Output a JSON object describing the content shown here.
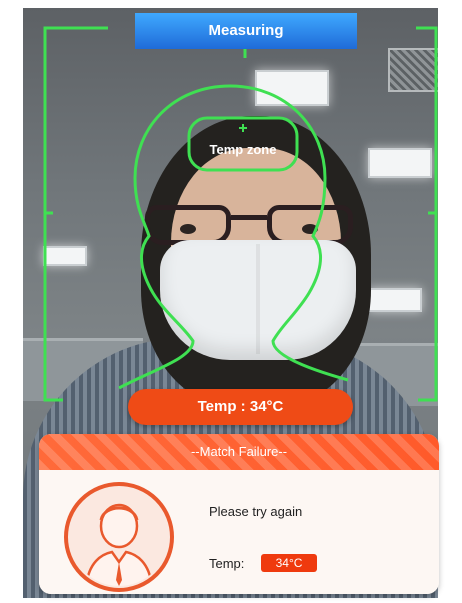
{
  "header": {
    "title": "Measuring"
  },
  "face_overlay": {
    "temp_zone_label": "Temp zone"
  },
  "temperature_bar": {
    "text": "Temp : 34°C"
  },
  "result_card": {
    "title": "--Match Failure--",
    "message": "Please try again",
    "temp_label": "Temp:",
    "temp_value": "34°C"
  },
  "colors": {
    "guide_green": "#3fe052",
    "title_blue": "#2f86ee",
    "alert_orange": "#ef4b16",
    "card_header_orange": "#ff6a3a"
  },
  "icons": [
    "person-avatar-icon",
    "crosshair-icon"
  ]
}
